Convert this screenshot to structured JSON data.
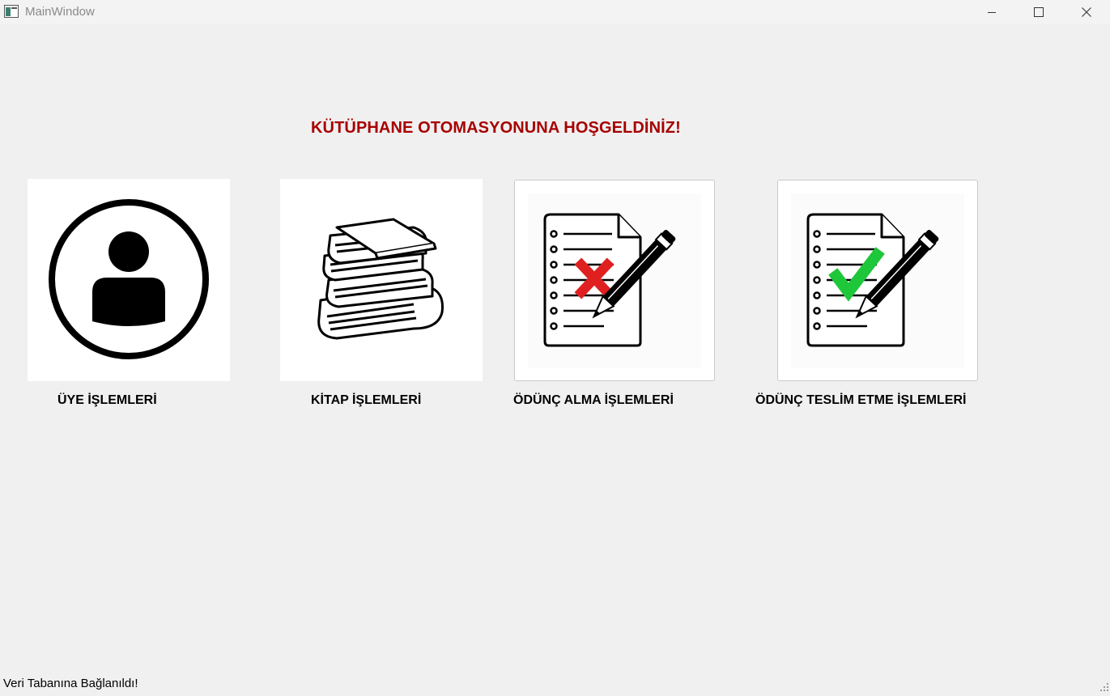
{
  "window": {
    "title": "MainWindow",
    "icon": "app-window-icon",
    "controls": [
      "minimize-icon",
      "maximize-icon",
      "close-icon"
    ]
  },
  "main": {
    "headline": "KÜTÜPHANE OTOMASYONUNA HOŞGELDİNİZ!",
    "headline_color": "#a80000",
    "modules": [
      {
        "label": "ÜYE İŞLEMLERİ",
        "icon": "member-user-icon"
      },
      {
        "label": "KİTAP İŞLEMLERİ",
        "icon": "books-stack-icon"
      },
      {
        "label": "ÖDÜNÇ ALMA İŞLEMLERİ",
        "icon": "document-red-cross-pencil-icon",
        "accent": "#e02020"
      },
      {
        "label": "ÖDÜNÇ TESLİM ETME İŞLEMLERİ",
        "icon": "document-green-check-pencil-icon",
        "accent": "#1ec63a"
      }
    ]
  },
  "status_bar": {
    "text": "Veri Tabanına Bağlanıldı!"
  }
}
